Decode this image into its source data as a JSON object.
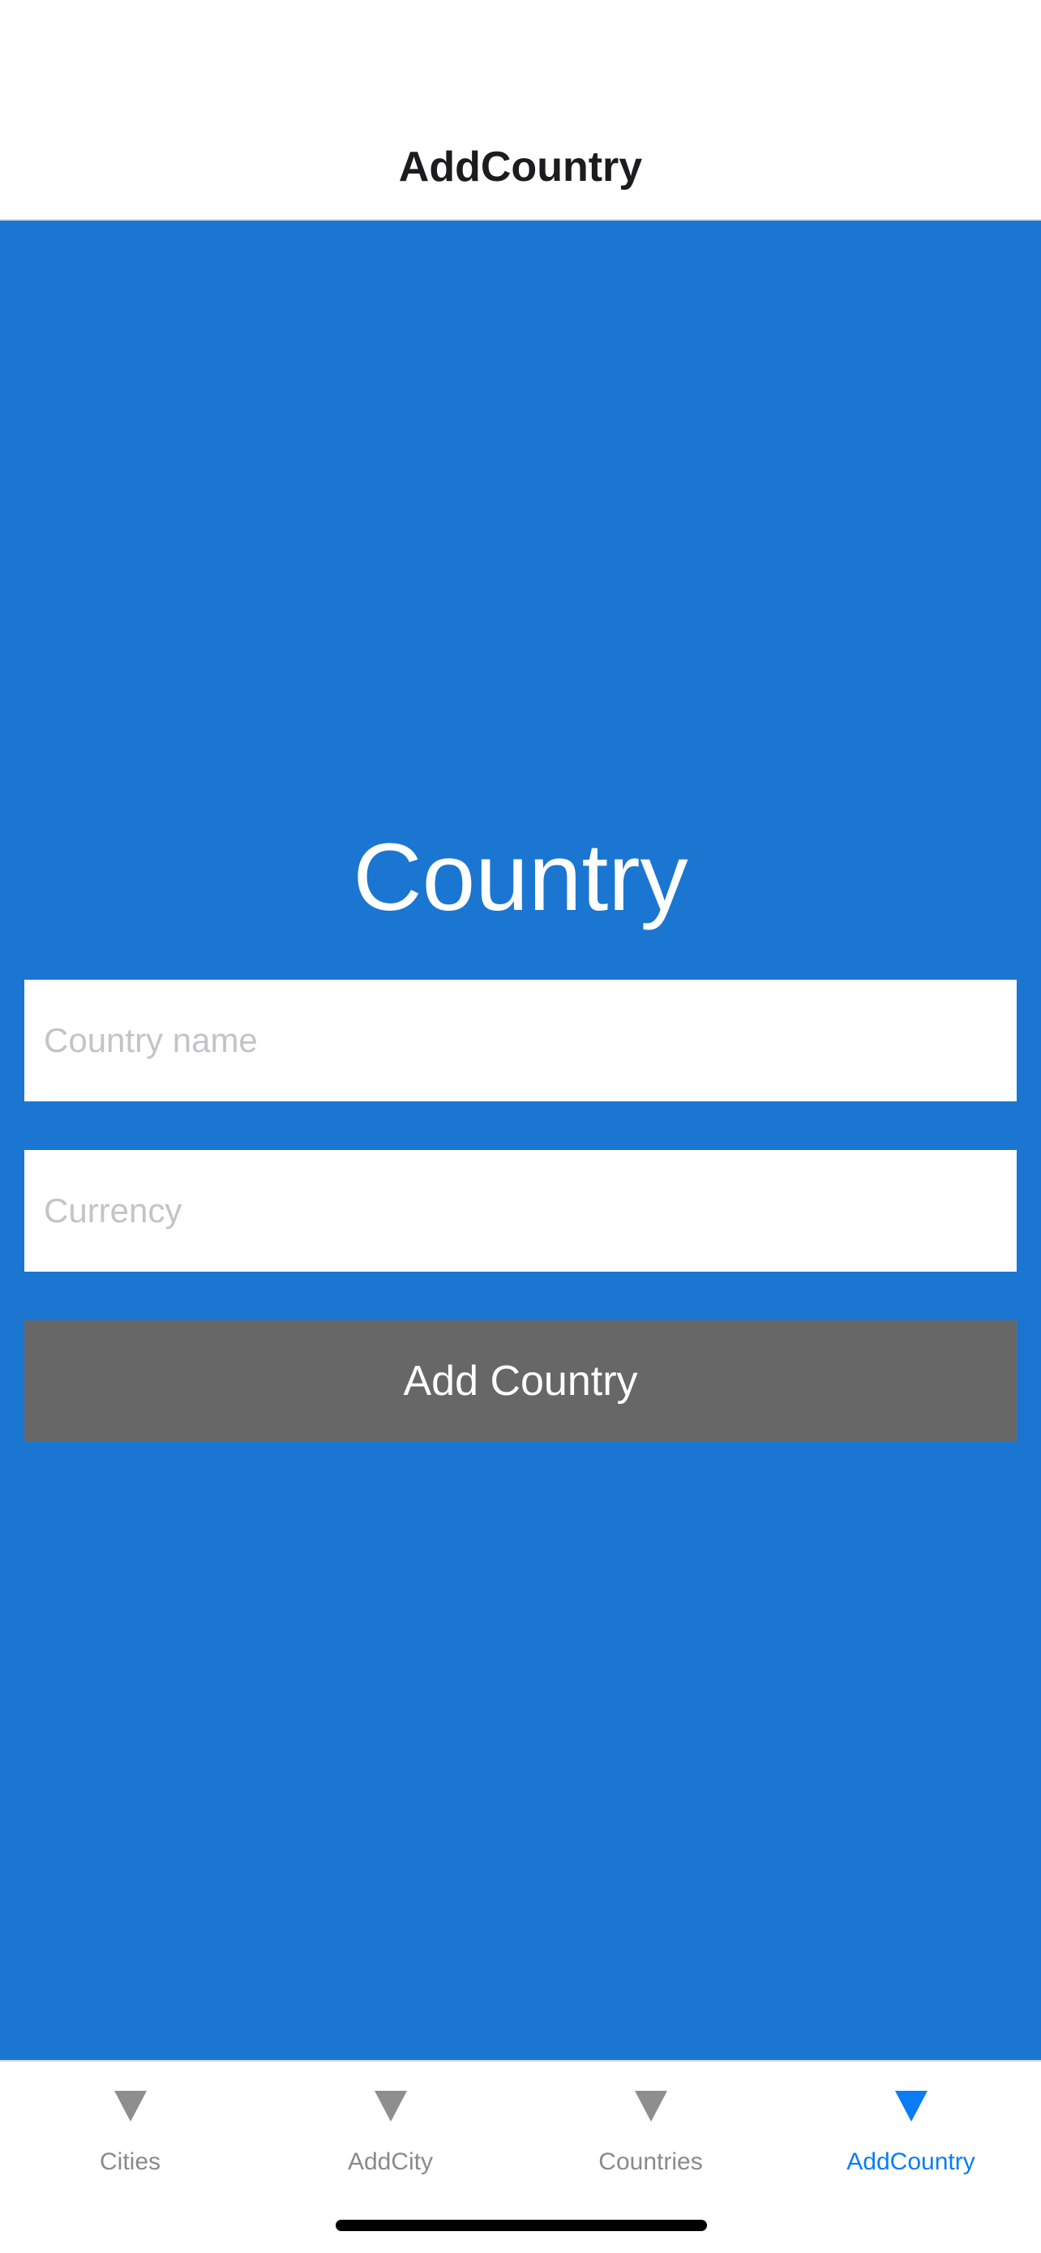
{
  "header": {
    "title": "AddCountry"
  },
  "form": {
    "heading": "Country",
    "country_name_placeholder": "Country name",
    "country_name_value": "",
    "currency_placeholder": "Currency",
    "currency_value": "",
    "submit_label": "Add Country"
  },
  "tabbar": {
    "tabs": [
      {
        "label": "Cities",
        "icon": "triangle-down-icon",
        "active": false
      },
      {
        "label": "AddCity",
        "icon": "triangle-down-icon",
        "active": false
      },
      {
        "label": "Countries",
        "icon": "triangle-down-icon",
        "active": false
      },
      {
        "label": "AddCountry",
        "icon": "triangle-down-icon",
        "active": true
      }
    ]
  },
  "colors": {
    "background": "#1b76d2",
    "button": "#676767",
    "tab_active": "#0a7cf6",
    "tab_inactive": "#8e8e8e"
  }
}
